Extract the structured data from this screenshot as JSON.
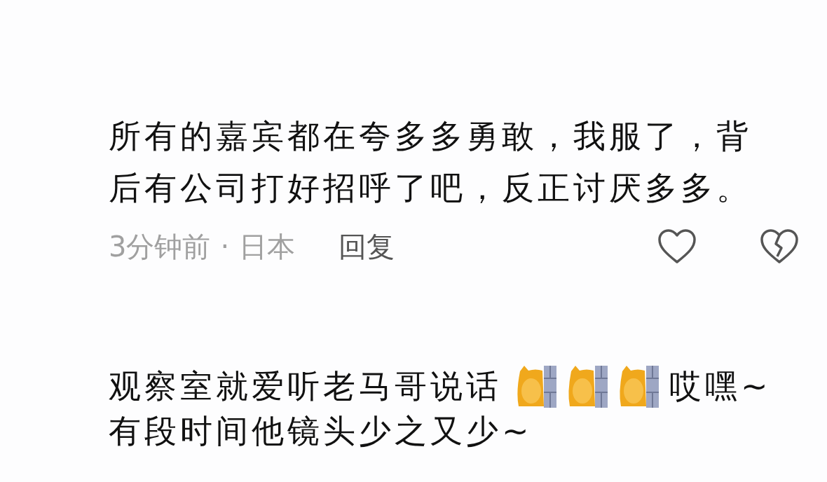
{
  "comments": [
    {
      "lines": [
        [
          {
            "kind": "text",
            "text": "所有的嘉宾都在夸多多勇敢，我服了，背"
          }
        ],
        [
          {
            "kind": "text",
            "text": "后有公司打好招呼了吧，反正讨厌多多。"
          }
        ]
      ],
      "meta": {
        "time": "3分钟前",
        "separator": "·",
        "location": "日本",
        "reply": "回复"
      },
      "liked": false,
      "disliked": false
    },
    {
      "lines": [
        [
          {
            "kind": "text",
            "text": "观察室就爱听老马哥说话"
          },
          {
            "kind": "emoji"
          },
          {
            "kind": "emoji"
          },
          {
            "kind": "emoji"
          },
          {
            "kind": "text",
            "text": "哎嘿~"
          }
        ],
        [
          {
            "kind": "text",
            "text": "有段时间他镜头少之又少~"
          }
        ]
      ]
    }
  ]
}
